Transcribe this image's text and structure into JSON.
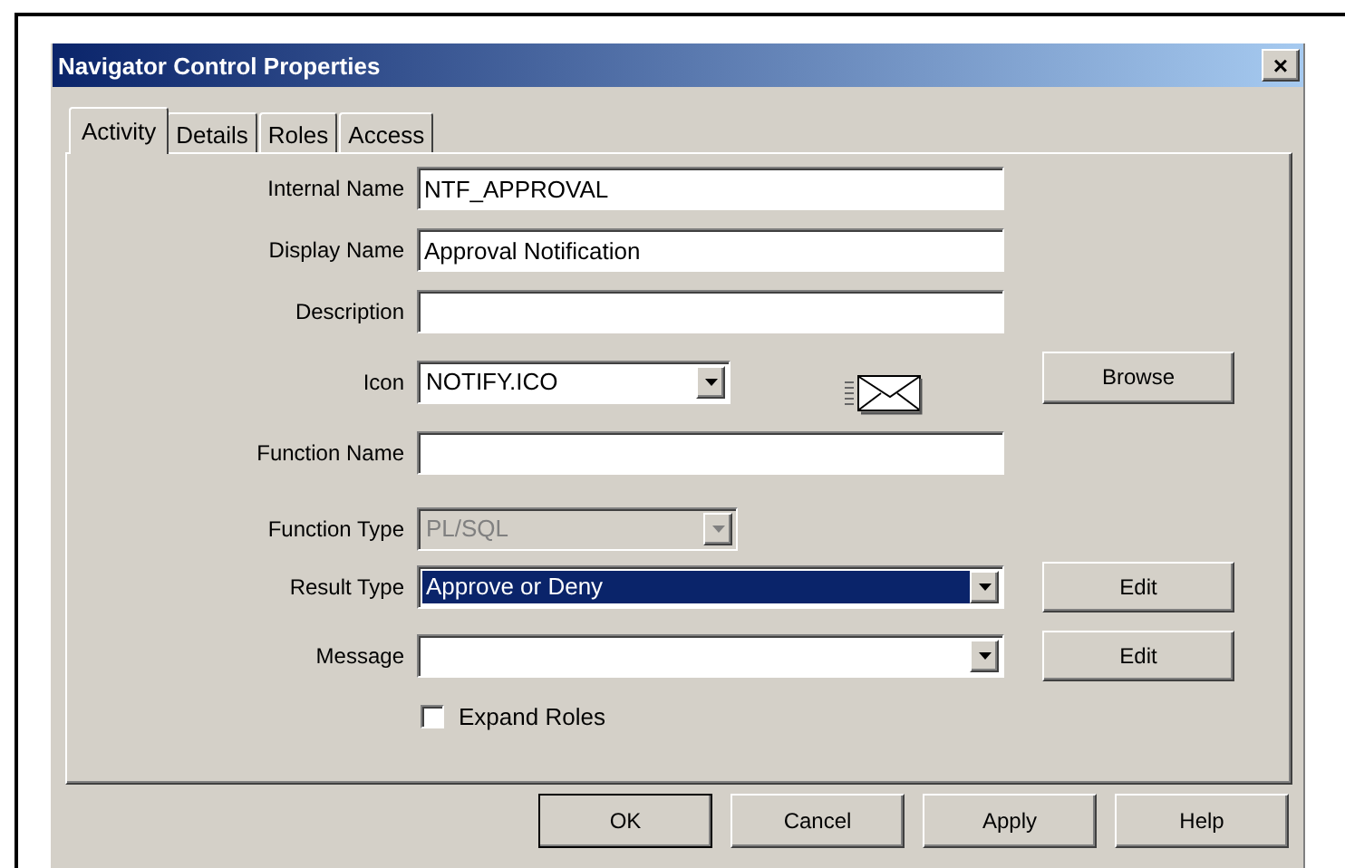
{
  "window": {
    "title": "Navigator Control Properties",
    "close": "×"
  },
  "tabs": [
    {
      "label": "Activity",
      "selected": true
    },
    {
      "label": "Details",
      "selected": false
    },
    {
      "label": "Roles",
      "selected": false
    },
    {
      "label": "Access",
      "selected": false
    }
  ],
  "fields": [
    {
      "kind": "text",
      "label": "Internal Name",
      "value": "NTF_APPROVAL"
    },
    {
      "kind": "text",
      "label": "Display Name",
      "value": "Approval Notification"
    },
    {
      "kind": "text",
      "label": "Description"
    },
    {
      "kind": "combo",
      "label": "Icon",
      "value": "NOTIFY.ICO",
      "disabled": false,
      "highlighted": false,
      "preview": true,
      "button": "Browse"
    },
    {
      "kind": "text",
      "label": "Function Name"
    },
    {
      "kind": "combo",
      "label": "Function Type",
      "value": "PL/SQL",
      "disabled": true,
      "highlighted": false
    },
    {
      "kind": "combo",
      "label": "Result Type",
      "value": "Approve or Deny",
      "disabled": false,
      "highlighted": true,
      "button": "Edit"
    },
    {
      "kind": "combo",
      "label": "Message",
      "disabled": false,
      "highlighted": false,
      "button": "Edit"
    },
    {
      "kind": "checkbox",
      "label": "Expand Roles",
      "checked": false
    }
  ],
  "buttons": [
    {
      "label": "OK",
      "default": true
    },
    {
      "label": "Cancel",
      "default": false
    },
    {
      "label": "Apply",
      "default": false
    },
    {
      "label": "Help",
      "default": false
    }
  ]
}
